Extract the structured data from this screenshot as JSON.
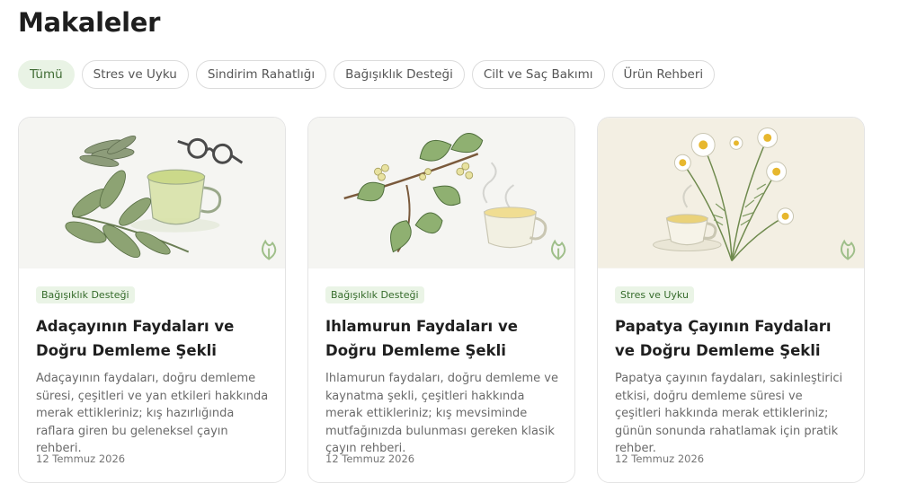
{
  "page": {
    "title": "Makaleler"
  },
  "filters": [
    {
      "label": "Tümü",
      "active": true
    },
    {
      "label": "Stres ve Uyku",
      "active": false
    },
    {
      "label": "Sindirim Rahatlığı",
      "active": false
    },
    {
      "label": "Bağışıklık Desteği",
      "active": false
    },
    {
      "label": "Cilt ve Saç Bakımı",
      "active": false
    },
    {
      "label": "Ürün Rehberi",
      "active": false
    }
  ],
  "articles": [
    {
      "tag": "Bağışıklık Desteği",
      "title": "Adaçayının Faydaları ve Doğru Demleme Şekli",
      "description": "Adaçayının faydaları, doğru demleme süresi, çeşitleri ve yan etkileri hakkında merak ettikleriniz; kış hazırlığında raflara giren bu geleneksel çayın rehberi.",
      "date": "12 Temmuz 2026",
      "image": "sage-tea-illustration"
    },
    {
      "tag": "Bağışıklık Desteği",
      "title": "Ihlamurun Faydaları ve Doğru Demleme Şekli",
      "description": "Ihlamurun faydaları, doğru demleme ve kaynatma şekli, çeşitleri hakkında merak ettikleriniz; kış mevsiminde mutfağınızda bulunması gereken klasik çayın rehberi.",
      "date": "12 Temmuz 2026",
      "image": "linden-tea-illustration"
    },
    {
      "tag": "Stres ve Uyku",
      "title": "Papatya Çayının Faydaları ve Doğru Demleme Şekli",
      "description": "Papatya çayının faydaları, sakinleştirici etkisi, doğru demleme süresi ve çeşitleri hakkında merak ettikleriniz; günün sonunda rahatlamak için pratik rehber.",
      "date": "12 Temmuz 2026",
      "image": "chamomile-tea-illustration"
    }
  ],
  "colors": {
    "accent": "#3f6b33",
    "chip_active_bg": "#e9f3e5",
    "tag_bg": "#eaf4e6",
    "tag_text": "#356b2b",
    "leaf_green": "#7c9a5c",
    "brand_logo": "#9fbf8a"
  }
}
